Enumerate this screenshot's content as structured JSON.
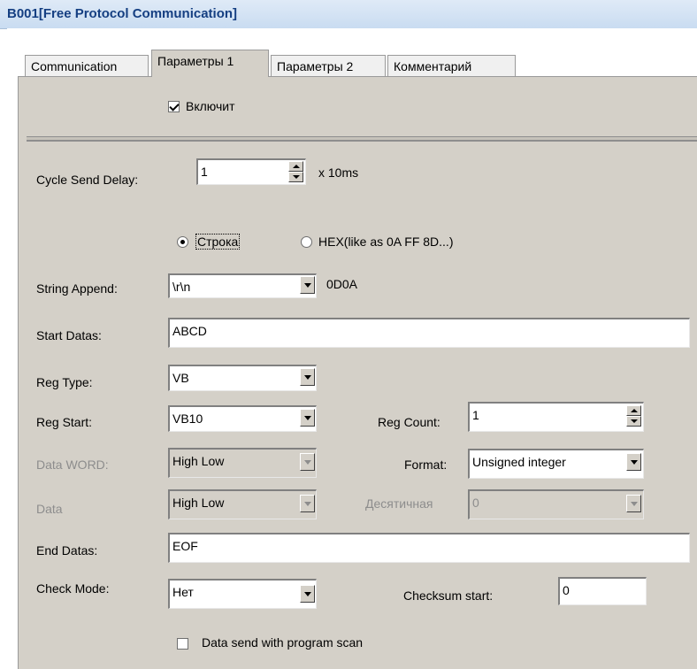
{
  "window": {
    "title": "B001[Free Protocol Communication]"
  },
  "tabs": [
    {
      "label": "Communication",
      "active": false
    },
    {
      "label": "Параметры 1",
      "active": true
    },
    {
      "label": "Параметры 2",
      "active": false
    },
    {
      "label": "Комментарий",
      "active": false
    }
  ],
  "enable": {
    "label": "Включит",
    "checked": true
  },
  "cycle_send_delay": {
    "label": "Cycle Send Delay:",
    "value": "1",
    "unit": "x 10ms"
  },
  "format_radio": {
    "string_label": "Строка",
    "string_selected": true,
    "hex_label": "HEX(like as 0A FF 8D...)",
    "hex_selected": false
  },
  "string_append": {
    "label": "String Append:",
    "value": "\\r\\n",
    "hex": "0D0A"
  },
  "start_datas": {
    "label": "Start Datas:",
    "value": "ABCD"
  },
  "reg_type": {
    "label": "Reg Type:",
    "value": "VB"
  },
  "reg_start": {
    "label": "Reg Start:",
    "value": "VB10"
  },
  "reg_count": {
    "label": "Reg Count:",
    "value": "1"
  },
  "data_word": {
    "label": "Data WORD:",
    "value": "High Low"
  },
  "format": {
    "label": "Format:",
    "value": "Unsigned integer"
  },
  "data": {
    "label": "Data",
    "value": "High Low"
  },
  "decimal": {
    "label": "Десятичная",
    "value": "0"
  },
  "end_datas": {
    "label": "End Datas:",
    "value": "EOF"
  },
  "check_mode": {
    "label": "Check Mode:",
    "value": "Нет"
  },
  "checksum_start": {
    "label": "Checksum start:",
    "value": "0"
  },
  "send_with_scan": {
    "label": "Data send with program scan",
    "checked": false
  }
}
